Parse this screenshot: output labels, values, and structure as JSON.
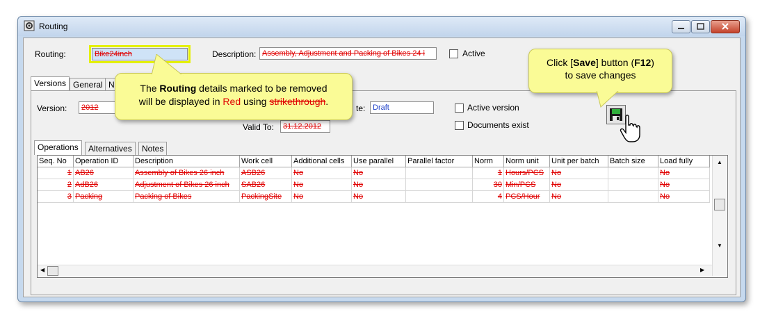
{
  "window": {
    "title": "Routing"
  },
  "header": {
    "routing_label": "Routing:",
    "routing_value": "Bike24inch",
    "description_label": "Description:",
    "description_value": "Assembly, Adjustment and Packing of Bikes 24 i",
    "active_label": "Active"
  },
  "tabs": [
    "Versions",
    "General",
    "N"
  ],
  "version": {
    "version_label": "Version:",
    "version_value": "2012",
    "state_label": "te:",
    "state_value": "Draft",
    "valid_to_label": "Valid To:",
    "valid_to_value": "31.12.2012",
    "active_version_label": "Active version",
    "documents_exist_label": "Documents exist"
  },
  "subtabs": [
    "Operations",
    "Alternatives",
    "Notes"
  ],
  "table": {
    "columns": [
      "Seq. No",
      "Operation ID",
      "Description",
      "Work cell",
      "Additional cells",
      "Use parallel",
      "Parallel factor",
      "Norm",
      "Norm unit",
      "Unit per batch",
      "Batch size",
      "Load fully"
    ],
    "rows": [
      [
        "1",
        "AB26",
        "Assembly of Bikes 26 inch",
        "ASB26",
        "No",
        "No",
        "",
        "1",
        "Hours/PCS",
        "No",
        "",
        "No"
      ],
      [
        "2",
        "AdB26",
        "Adjustment of Bikes 26 inch",
        "SAB26",
        "No",
        "No",
        "",
        "30",
        "Min/PCS",
        "No",
        "",
        "No"
      ],
      [
        "3",
        "Packing",
        "Packing of Bikes",
        "PackingSite",
        "No",
        "No",
        "",
        "4",
        "PCS/Hour",
        "No",
        "",
        "No"
      ]
    ]
  },
  "callouts": {
    "left": {
      "line1_pre": "The ",
      "line1_bold": "Routing",
      "line1_post": " details marked to be removed",
      "line2_pre": "will be displayed in ",
      "line2_red": "Red",
      "line2_mid": " using ",
      "line2_strike": "strikethrough",
      "line2_post": "."
    },
    "right": {
      "line1_pre": "Click [",
      "line1_bold": "Save",
      "line1_mid": "] button (",
      "line1_bold2": "F12",
      "line1_post": ")",
      "line2": "to save changes"
    }
  },
  "colors": {
    "deleted": "#e00000",
    "callout_bg": "#fafb96",
    "highlight_border": "#e4f000"
  },
  "icons": [
    "app-icon",
    "minimize-icon",
    "maximize-icon",
    "close-icon",
    "save-icon",
    "hand-cursor-icon"
  ]
}
